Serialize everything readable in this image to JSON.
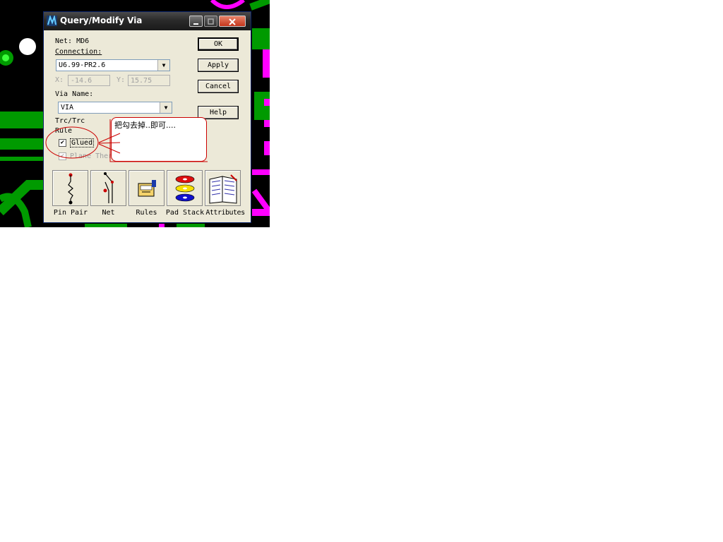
{
  "dialog": {
    "title": "Query/Modify Via",
    "net_label": "Net: MD6",
    "connection_label": "Connection:",
    "connection_value": "U6.99-PR2.6",
    "x_label": "X:",
    "x_value": "-14.6",
    "y_label": "Y:",
    "y_value": "15.75",
    "via_name_label": "Via Name:",
    "via_name_value": "VIA",
    "trc_label": "Trc/Trc",
    "rule_label": "Rule",
    "glued_label": "Glued",
    "glued_checked": true,
    "plane_label": "Plane Therm",
    "plane_checked": true
  },
  "buttons": {
    "ok": "OK",
    "apply": "Apply",
    "cancel": "Cancel",
    "help": "Help"
  },
  "tiles": [
    {
      "label": "Pin Pair",
      "icon": "pin-pair-icon"
    },
    {
      "label": "Net",
      "icon": "net-icon"
    },
    {
      "label": "Rules",
      "icon": "rules-icon"
    },
    {
      "label": "Pad Stack",
      "icon": "pad-stack-icon"
    },
    {
      "label": "Attributes",
      "icon": "attributes-icon"
    }
  ],
  "annotation": {
    "text": "把勾去掉..即可....",
    "color": "#cc0000"
  },
  "colors": {
    "pcb_background": "#000000",
    "pcb_green": "#009a00",
    "pcb_magenta": "#ff00ff",
    "dialog_face": "#ece9d8"
  }
}
